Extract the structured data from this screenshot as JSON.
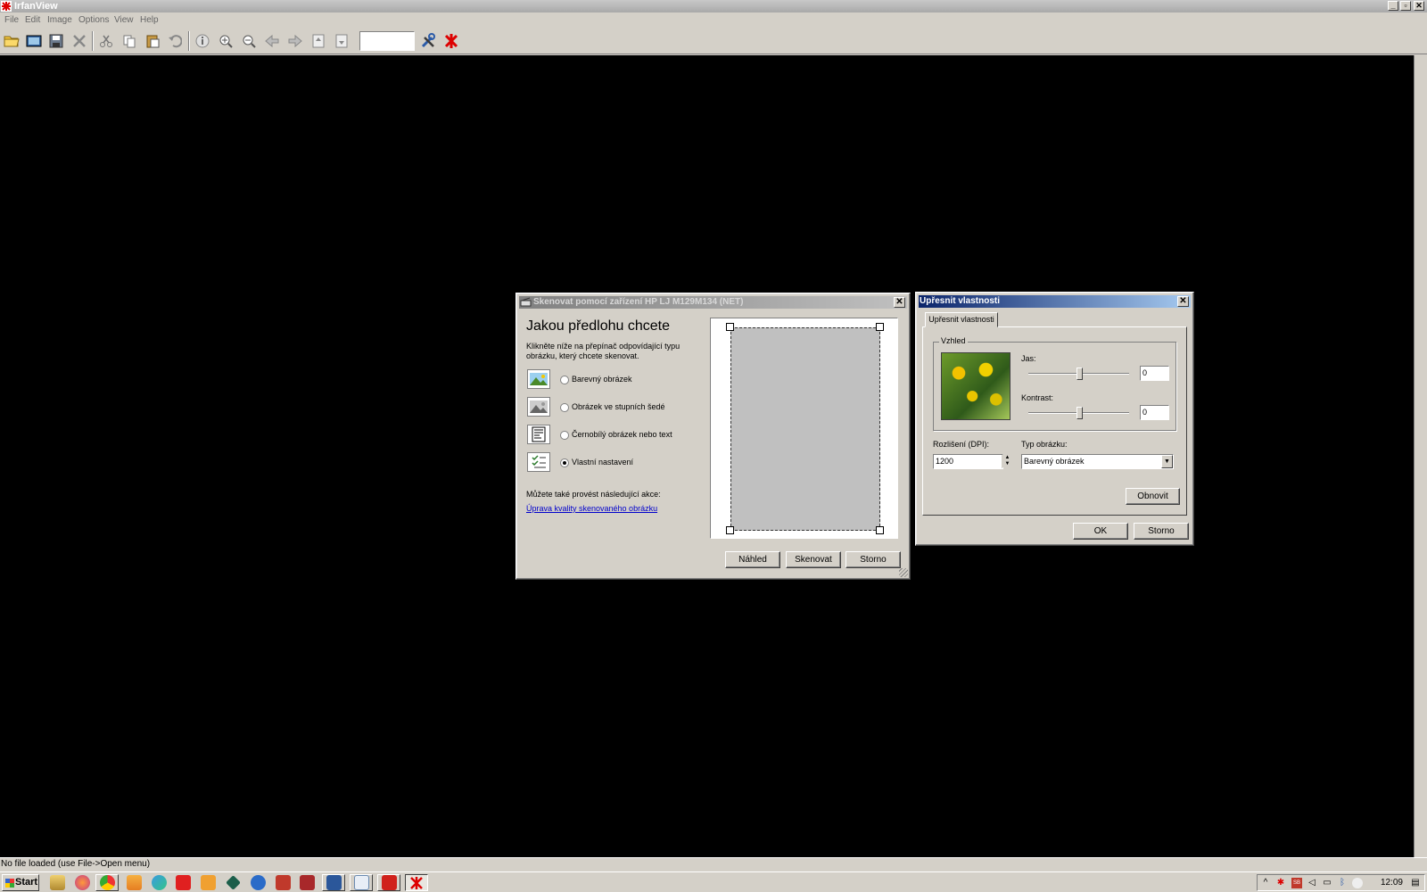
{
  "window": {
    "title": "IrfanView",
    "minimize": "_",
    "maximize": "▫",
    "close": "✕"
  },
  "menu": [
    "File",
    "Edit",
    "Image",
    "Options",
    "View",
    "Help"
  ],
  "toolbar": {
    "zoom_value": ""
  },
  "status": {
    "text": "No file loaded (use File->Open menu)"
  },
  "taskbar": {
    "start_label": "Start",
    "clock": "12:09"
  },
  "scan_dialog": {
    "title": "Skenovat pomocí zařízení HP LJ M129M134 (NET)",
    "close": "✕",
    "heading": "Jakou předlohu chcete",
    "description": "Klikněte níže na přepínač odpovídající typu obrázku, který chcete skenovat.",
    "options": [
      {
        "label": "Barevný obrázek",
        "checked": false
      },
      {
        "label": "Obrázek ve stupních šedé",
        "checked": false
      },
      {
        "label": "Černobílý obrázek nebo text",
        "checked": false
      },
      {
        "label": "Vlastní nastavení",
        "checked": true
      }
    ],
    "actions_label": "Můžete také provést následující akce:",
    "link_label": "Úprava kvality skenovaného obrázku",
    "preview_button": "Náhled",
    "scan_button": "Skenovat",
    "cancel_button": "Storno"
  },
  "props_dialog": {
    "title": "Upřesnit vlastnosti",
    "close": "✕",
    "tab_label": "Upřesnit vlastnosti",
    "preview_group_label": "Vzhled",
    "brightness_label": "Jas:",
    "brightness_value": "0",
    "contrast_label": "Kontrast:",
    "contrast_value": "0",
    "resolution_label": "Rozlišení (DPI):",
    "resolution_value": "1200",
    "image_type_label": "Typ obrázku:",
    "image_type_value": "Barevný obrázek",
    "reset_button": "Obnovit",
    "ok_button": "OK",
    "cancel_button": "Storno"
  }
}
